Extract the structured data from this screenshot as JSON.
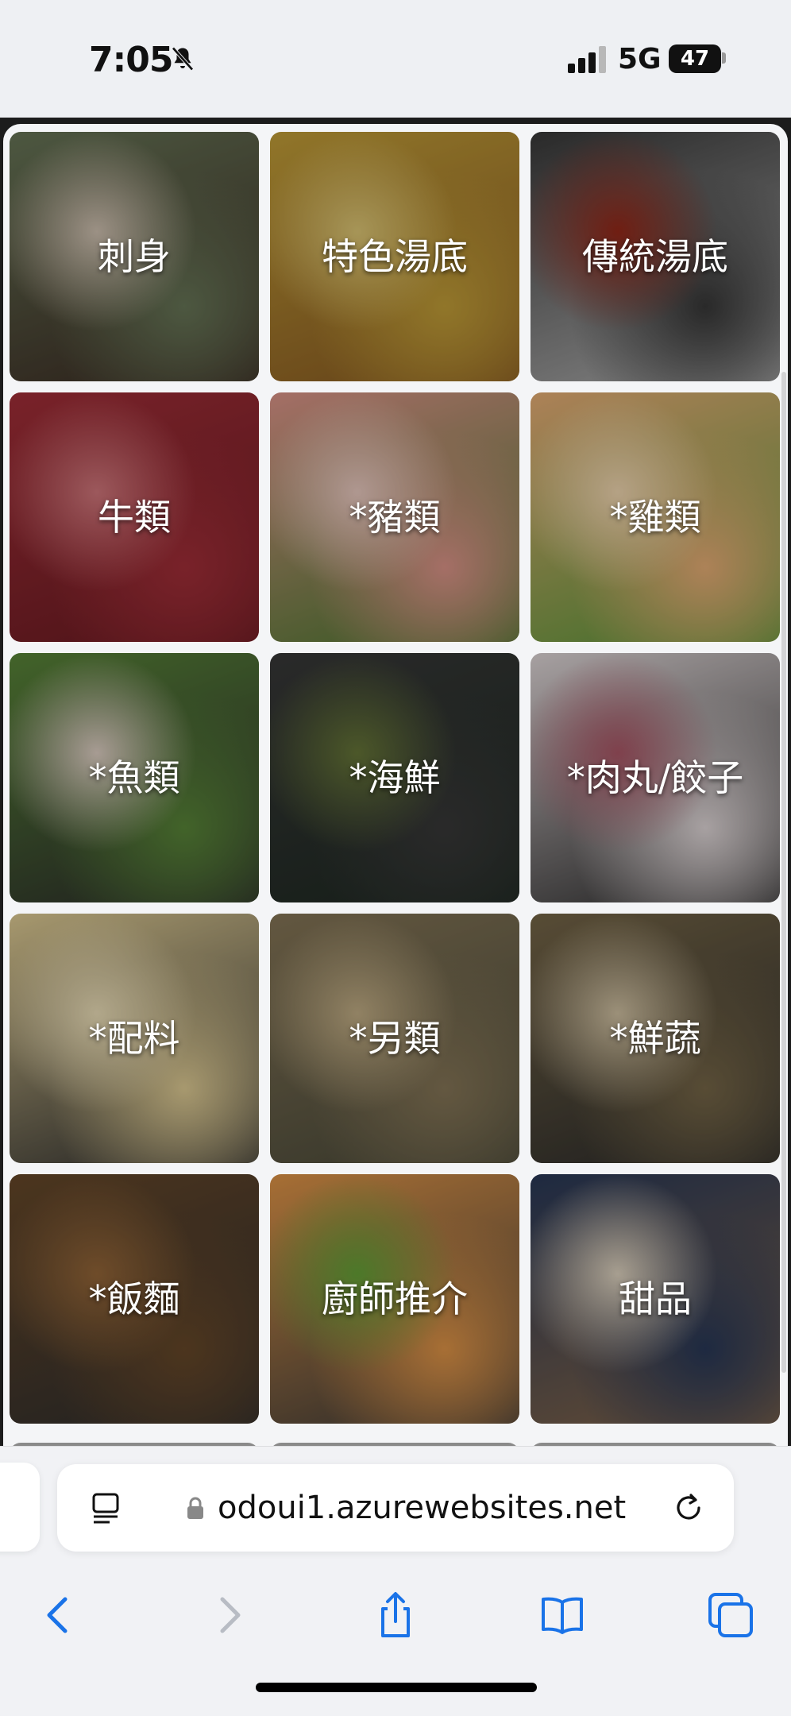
{
  "status": {
    "time": "7:05",
    "network": "5G",
    "battery": "47"
  },
  "tiles": [
    {
      "label": "刺身",
      "colors": [
        "#6b7a5a",
        "#d8c9b8",
        "#3b2a22"
      ]
    },
    {
      "label": "特色湯底",
      "colors": [
        "#c9a43a",
        "#e7cf7a",
        "#8a5a22"
      ]
    },
    {
      "label": "傳統湯底",
      "colors": [
        "#3a3a3a",
        "#9b2a1a",
        "#b9b9b9"
      ]
    },
    {
      "label": "牛類",
      "colors": [
        "#a8303a",
        "#d97b80",
        "#6b1b22"
      ]
    },
    {
      "label": "*豬類",
      "colors": [
        "#e59a8e",
        "#f3d2c8",
        "#4a7a2e"
      ]
    },
    {
      "label": "*雞類",
      "colors": [
        "#f0b47a",
        "#fbe0b8",
        "#5a9a3a"
      ]
    },
    {
      "label": "*魚類",
      "colors": [
        "#5c8a3a",
        "#e8d8cc",
        "#2b2b2b"
      ]
    },
    {
      "label": "*海鮮",
      "colors": [
        "#3a3a3a",
        "#6a7a3a",
        "#1e2a22"
      ]
    },
    {
      "label": "*肉丸/餃子",
      "colors": [
        "#e8dfe0",
        "#b05a6a",
        "#2a2a2a"
      ]
    },
    {
      "label": "*配料",
      "colors": [
        "#e8d49a",
        "#f6e8c0",
        "#2e2e2e"
      ]
    },
    {
      "label": "*另類",
      "colors": [
        "#8a7a5a",
        "#c9b48a",
        "#4a4a3a"
      ]
    },
    {
      "label": "*鮮蔬",
      "colors": [
        "#7a6a4a",
        "#d8c8a8",
        "#2a2a2a"
      ]
    },
    {
      "label": "*飯麵",
      "colors": [
        "#6a4a2a",
        "#9a6a3a",
        "#2e2e2e"
      ]
    },
    {
      "label": "廚師推介",
      "colors": [
        "#e89a4a",
        "#6aa83a",
        "#3a3a3a"
      ]
    },
    {
      "label": "甜品",
      "colors": [
        "#2a3a5a",
        "#e8dcc8",
        "#8a6a4a"
      ]
    }
  ],
  "browser": {
    "url": "odoui1.azurewebsites.net"
  },
  "icons": {
    "mute": "bell-slash-icon",
    "reader": "reader-icon",
    "lock": "lock-icon",
    "reload": "reload-icon",
    "back": "back-arrow-icon",
    "forward": "forward-arrow-icon",
    "share": "share-icon",
    "bookmarks": "book-icon",
    "tabs": "tabs-icon"
  },
  "accent": "#1a73e8"
}
